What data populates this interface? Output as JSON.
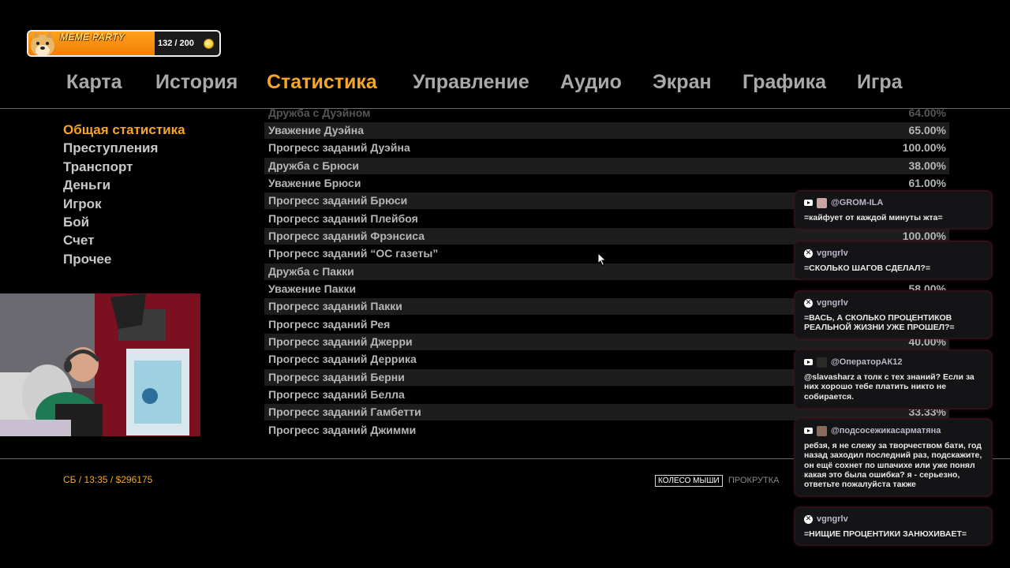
{
  "meme_widget": {
    "title": "MEME PARTY",
    "count": "132 / 200",
    "progress": 0.66,
    "fill_color": "#f7921e",
    "icon": "doge-icon"
  },
  "tabs": [
    {
      "label": "Карта",
      "active": false
    },
    {
      "label": "История",
      "active": false
    },
    {
      "label": "Статистика",
      "active": true
    },
    {
      "label": "Управление",
      "active": false
    },
    {
      "label": "Аудио",
      "active": false
    },
    {
      "label": "Экран",
      "active": false
    },
    {
      "label": "Графика",
      "active": false
    },
    {
      "label": "Игра",
      "active": false
    }
  ],
  "side_menu": [
    {
      "label": "Общая статистика",
      "active": true
    },
    {
      "label": "Преступления",
      "active": false
    },
    {
      "label": "Транспорт",
      "active": false
    },
    {
      "label": "Деньги",
      "active": false
    },
    {
      "label": "Игрок",
      "active": false
    },
    {
      "label": "Бой",
      "active": false
    },
    {
      "label": "Счет",
      "active": false
    },
    {
      "label": "Прочее",
      "active": false
    }
  ],
  "stats": [
    {
      "label": "Дружба с Дуэйном",
      "value": "64.00%"
    },
    {
      "label": "Уважение Дуэйна",
      "value": "65.00%"
    },
    {
      "label": "Прогресс заданий Дуэйна",
      "value": "100.00%"
    },
    {
      "label": "Дружба с Брюси",
      "value": "38.00%"
    },
    {
      "label": "Уважение Брюси",
      "value": "61.00%"
    },
    {
      "label": "Прогресс заданий Брюси",
      "value": ""
    },
    {
      "label": "Прогресс заданий Плейбоя",
      "value": ""
    },
    {
      "label": "Прогресс заданий Фрэнсиса",
      "value": "100.00%"
    },
    {
      "label": "Прогресс заданий “ОС газеты”",
      "value": ""
    },
    {
      "label": "Дружба с Пакки",
      "value": ""
    },
    {
      "label": "Уважение Пакки",
      "value": "58.00%"
    },
    {
      "label": "Прогресс заданий Пакки",
      "value": ""
    },
    {
      "label": "Прогресс заданий Рея",
      "value": ""
    },
    {
      "label": "Прогресс заданий Джерри",
      "value": "40.00%"
    },
    {
      "label": "Прогресс заданий Деррика",
      "value": ""
    },
    {
      "label": "Прогресс заданий Берни",
      "value": ""
    },
    {
      "label": "Прогресс заданий Белла",
      "value": ""
    },
    {
      "label": "Прогресс заданий Гамбетти",
      "value": "33.33%"
    },
    {
      "label": "Прогресс заданий Джимми",
      "value": ""
    }
  ],
  "footer": {
    "info": "СБ / 13:35 / $296175",
    "hint_key": "КОЛЕСО МЫШИ",
    "hint_text": "ПРОКРУТКА"
  },
  "chat": [
    {
      "source": "youtube",
      "user": "@GROM-ILA",
      "text": "=кайфует от каждой минуты жта="
    },
    {
      "source": "x",
      "user": "vgngrlv",
      "text": "=СКОЛЬКО ШАГОВ СДЕЛАЛ?="
    },
    {
      "source": "x",
      "user": "vgngrlv",
      "text": "=ВАСЬ, А СКОЛЬКО ПРОЦЕНТИКОВ РЕАЛЬНОЙ ЖИЗНИ УЖЕ ПРОШЕЛ?="
    },
    {
      "source": "youtube",
      "user": "@ОператорАК12",
      "text": "@slavasharz а толк с тех знаний? Если за них хорошо тебе платить никто не собирается."
    },
    {
      "source": "youtube",
      "user": "@подсосежикасарматяна",
      "text": "ребзя, я не слежу за творчеством бати, год назад заходил последний раз, подскажите, он ещё сохнет по шпачихе или уже понял какая это была ошибка? я - серьезно, ответьте пожалуйста также"
    },
    {
      "source": "x",
      "user": "vgngrlv",
      "text": "=НИЩИЕ ПРОЦЕНТИКИ ЗАНЮХИВАЕТ="
    }
  ]
}
